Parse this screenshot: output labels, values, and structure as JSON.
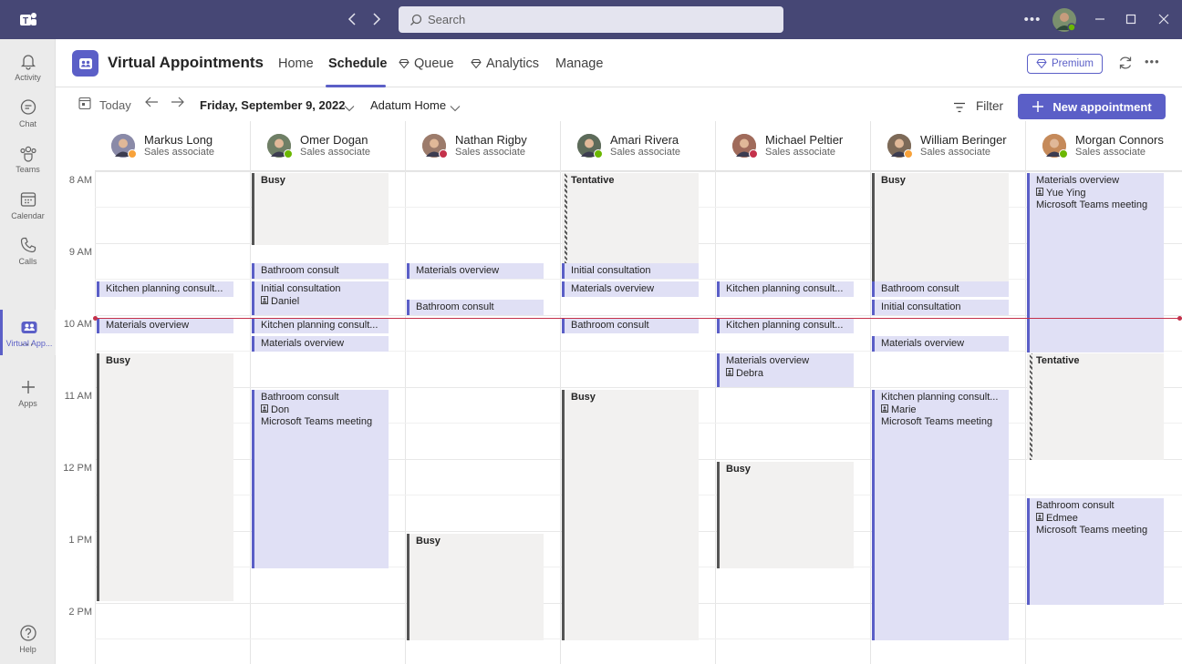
{
  "titlebar": {
    "search_placeholder": "Search"
  },
  "rail": {
    "items": [
      {
        "label": "Activity",
        "icon": "bell-icon"
      },
      {
        "label": "Chat",
        "icon": "chat-icon"
      },
      {
        "label": "Teams",
        "icon": "teams-icon"
      },
      {
        "label": "Calendar",
        "icon": "calendar-icon"
      },
      {
        "label": "Calls",
        "icon": "phone-icon"
      },
      {
        "label": "Virtual App...",
        "icon": "virtual-appointments-icon"
      },
      {
        "label": "...",
        "icon": "more-icon"
      },
      {
        "label": "Apps",
        "icon": "plus-icon"
      },
      {
        "label": "Help",
        "icon": "help-icon"
      }
    ]
  },
  "header": {
    "app_title": "Virtual Appointments",
    "tabs": [
      "Home",
      "Schedule",
      "Queue",
      "Analytics",
      "Manage"
    ],
    "premium": "Premium"
  },
  "toolbar": {
    "today": "Today",
    "date": "Friday, September 9, 2022",
    "location": "Adatum Home",
    "filter": "Filter",
    "new_appointment": "New appointment"
  },
  "staff": [
    {
      "name": "Markus Long",
      "role": "Sales associate",
      "presence": "away"
    },
    {
      "name": "Omer Dogan",
      "role": "Sales associate",
      "presence": "available"
    },
    {
      "name": "Nathan Rigby",
      "role": "Sales associate",
      "presence": "busy"
    },
    {
      "name": "Amari Rivera",
      "role": "Sales associate",
      "presence": "available"
    },
    {
      "name": "Michael Peltier",
      "role": "Sales associate",
      "presence": "busy"
    },
    {
      "name": "William Beringer",
      "role": "Sales associate",
      "presence": "away"
    },
    {
      "name": "Morgan Connors",
      "role": "Sales associate",
      "presence": "available"
    }
  ],
  "hours": [
    "8 AM",
    "9 AM",
    "10 AM",
    "11 AM",
    "12 PM",
    "1 PM",
    "2 PM"
  ],
  "events": [
    {
      "col": 0,
      "type": "appt",
      "title": "Kitchen planning consult...",
      "lines": []
    },
    {
      "col": 0,
      "type": "appt",
      "title": "Materials overview",
      "lines": []
    },
    {
      "col": 0,
      "type": "busy",
      "title": "Busy",
      "lines": []
    },
    {
      "col": 1,
      "type": "busy",
      "title": "Busy",
      "lines": []
    },
    {
      "col": 1,
      "type": "appt",
      "title": "Bathroom consult",
      "lines": []
    },
    {
      "col": 1,
      "type": "appt",
      "title": "Initial consultation",
      "lines": [
        "Daniel"
      ]
    },
    {
      "col": 1,
      "type": "appt",
      "title": "Kitchen planning consult...",
      "lines": []
    },
    {
      "col": 1,
      "type": "appt",
      "title": "Materials overview",
      "lines": []
    },
    {
      "col": 1,
      "type": "appt",
      "title": "Bathroom consult",
      "lines": [
        "Don",
        "Microsoft Teams meeting"
      ]
    },
    {
      "col": 2,
      "type": "appt",
      "title": "Materials overview",
      "lines": []
    },
    {
      "col": 2,
      "type": "appt",
      "title": "Bathroom consult",
      "lines": []
    },
    {
      "col": 2,
      "type": "busy",
      "title": "Busy",
      "lines": []
    },
    {
      "col": 3,
      "type": "tent",
      "title": "Tentative",
      "lines": []
    },
    {
      "col": 3,
      "type": "appt",
      "title": "Initial consultation",
      "lines": []
    },
    {
      "col": 3,
      "type": "appt",
      "title": "Materials overview",
      "lines": []
    },
    {
      "col": 3,
      "type": "appt",
      "title": "Bathroom consult",
      "lines": []
    },
    {
      "col": 3,
      "type": "busy",
      "title": "Busy",
      "lines": []
    },
    {
      "col": 4,
      "type": "appt",
      "title": "Kitchen planning consult...",
      "lines": []
    },
    {
      "col": 4,
      "type": "appt",
      "title": "Kitchen planning consult...",
      "lines": []
    },
    {
      "col": 4,
      "type": "appt",
      "title": "Materials overview",
      "lines": [
        "Debra"
      ]
    },
    {
      "col": 4,
      "type": "busy",
      "title": "Busy",
      "lines": []
    },
    {
      "col": 5,
      "type": "busy",
      "title": "Busy",
      "lines": []
    },
    {
      "col": 5,
      "type": "appt",
      "title": "Bathroom consult",
      "lines": []
    },
    {
      "col": 5,
      "type": "appt",
      "title": "Initial consultation",
      "lines": []
    },
    {
      "col": 5,
      "type": "appt",
      "title": "Materials overview",
      "lines": []
    },
    {
      "col": 5,
      "type": "appt",
      "title": "Kitchen planning consult...",
      "lines": [
        "Marie",
        "Microsoft Teams meeting"
      ]
    },
    {
      "col": 6,
      "type": "appt",
      "title": "Materials overview",
      "lines": [
        "Yue Ying",
        "Microsoft Teams meeting"
      ]
    },
    {
      "col": 6,
      "type": "tent",
      "title": "Tentative",
      "lines": []
    },
    {
      "col": 6,
      "type": "appt",
      "title": "Bathroom consult",
      "lines": [
        "Edmee",
        "Microsoft Teams meeting"
      ]
    }
  ],
  "colors": {
    "titlebar": "#464775",
    "accent": "#5b5fc7",
    "appointment": "#e0e0f5",
    "busy": "#f2f1f0",
    "now_line": "#c4314b"
  }
}
